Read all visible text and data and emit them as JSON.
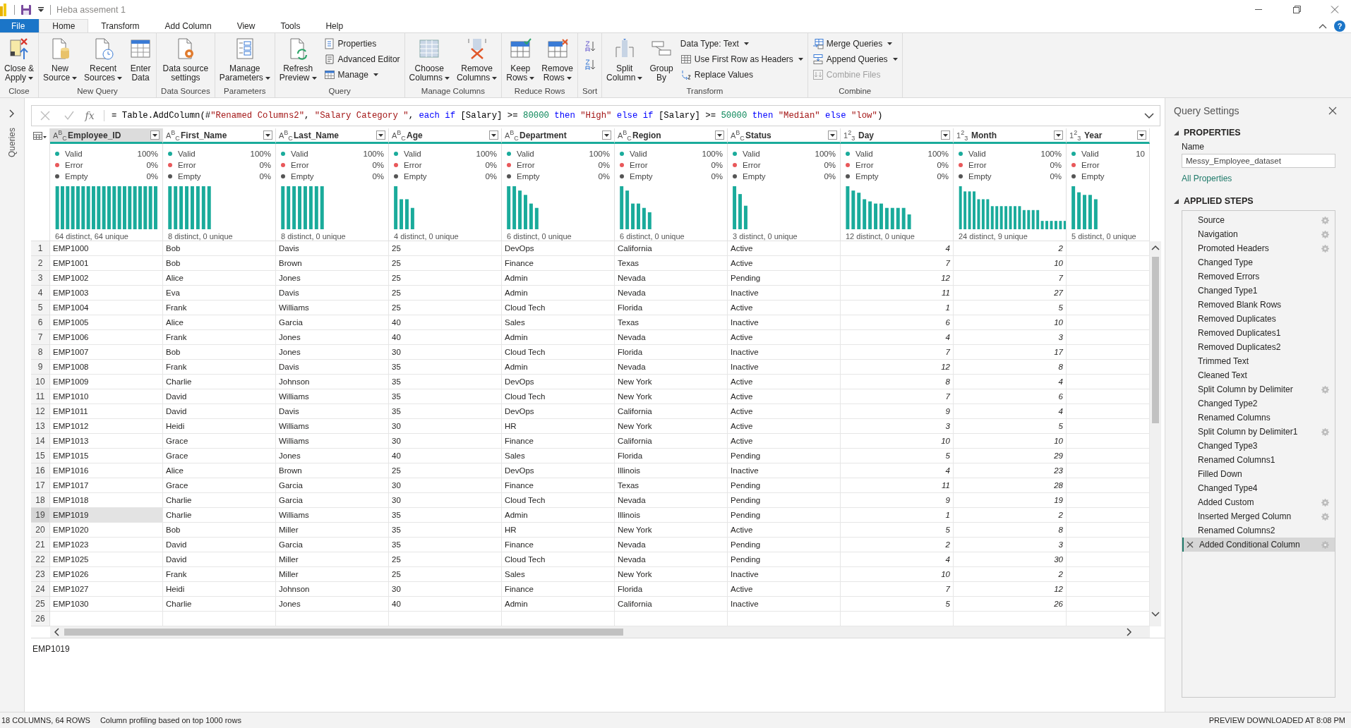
{
  "window": {
    "title": "Heba assement 1"
  },
  "tabs": [
    {
      "label": "File",
      "kind": "file",
      "selected": false
    },
    {
      "label": "Home",
      "kind": "tab",
      "selected": true
    },
    {
      "label": "Transform",
      "kind": "tab",
      "selected": false
    },
    {
      "label": "Add Column",
      "kind": "tab",
      "selected": false
    },
    {
      "label": "View",
      "kind": "tab",
      "selected": false
    },
    {
      "label": "Tools",
      "kind": "tab",
      "selected": false
    },
    {
      "label": "Help",
      "kind": "tab",
      "selected": false
    }
  ],
  "help_button": "?",
  "ribbon": [
    {
      "label": "Close",
      "items": [
        {
          "kind": "large",
          "label": "Close &\nApply",
          "dropdown": true,
          "disabled": false
        }
      ]
    },
    {
      "label": "New Query",
      "items": [
        {
          "kind": "large",
          "label": "New\nSource",
          "dropdown": true,
          "disabled": false
        },
        {
          "kind": "large",
          "label": "Recent\nSources",
          "dropdown": true,
          "disabled": false
        },
        {
          "kind": "large",
          "label": "Enter\nData",
          "dropdown": false,
          "disabled": false
        }
      ]
    },
    {
      "label": "Data Sources",
      "items": [
        {
          "kind": "large",
          "label": "Data source\nsettings",
          "dropdown": false,
          "disabled": false
        }
      ]
    },
    {
      "label": "Parameters",
      "items": [
        {
          "kind": "large",
          "label": "Manage\nParameters",
          "dropdown": true,
          "disabled": false
        }
      ]
    },
    {
      "label": "Query",
      "items": [
        {
          "kind": "large",
          "label": "Refresh\nPreview",
          "dropdown": true,
          "disabled": false
        },
        {
          "kind": "small",
          "label": "Properties",
          "dropdown": false,
          "disabled": false
        },
        {
          "kind": "small",
          "label": "Advanced Editor",
          "dropdown": false,
          "disabled": false
        },
        {
          "kind": "small",
          "label": "Manage",
          "dropdown": true,
          "disabled": false
        }
      ]
    },
    {
      "label": "Manage Columns",
      "items": [
        {
          "kind": "large",
          "label": "Choose\nColumns",
          "dropdown": true,
          "disabled": false
        },
        {
          "kind": "large",
          "label": "Remove\nColumns",
          "dropdown": true,
          "disabled": false
        }
      ]
    },
    {
      "label": "Reduce Rows",
      "items": [
        {
          "kind": "large",
          "label": "Keep\nRows",
          "dropdown": true,
          "disabled": false
        },
        {
          "kind": "large",
          "label": "Remove\nRows",
          "dropdown": true,
          "disabled": false
        }
      ]
    },
    {
      "label": "Sort",
      "items": [
        {
          "kind": "icon"
        },
        {
          "kind": "icon"
        }
      ]
    },
    {
      "label": "Transform",
      "items": [
        {
          "kind": "large",
          "label": "Split\nColumn",
          "dropdown": true,
          "disabled": false
        },
        {
          "kind": "large",
          "label": "Group\nBy",
          "dropdown": false,
          "disabled": false
        },
        {
          "kind": "small",
          "label": "Data Type: Text",
          "dropdown": true,
          "disabled": false
        },
        {
          "kind": "small",
          "label": "Use First Row as Headers",
          "dropdown": true,
          "disabled": false
        },
        {
          "kind": "small",
          "label": "Replace Values",
          "dropdown": false,
          "disabled": false
        }
      ]
    },
    {
      "label": "Combine",
      "items": [
        {
          "kind": "small",
          "label": "Merge Queries",
          "dropdown": true,
          "disabled": false
        },
        {
          "kind": "small",
          "label": "Append Queries",
          "dropdown": true,
          "disabled": false
        },
        {
          "kind": "small",
          "label": "Combine Files",
          "dropdown": false,
          "disabled": true
        }
      ]
    }
  ],
  "queries_pane": {
    "label": "Queries"
  },
  "formula_bar": {
    "fx": "fx",
    "tokens": [
      {
        "kind": "plain",
        "text": "= Table.AddColumn(#"
      },
      {
        "kind": "string",
        "text": "\"Renamed Columns2\""
      },
      {
        "kind": "plain",
        "text": ", "
      },
      {
        "kind": "string",
        "text": "\"Salary Category \""
      },
      {
        "kind": "plain",
        "text": ", "
      },
      {
        "kind": "keyword",
        "text": "each if"
      },
      {
        "kind": "plain",
        "text": " [Salary] >= "
      },
      {
        "kind": "number",
        "text": "80000"
      },
      {
        "kind": "keyword",
        "text": " then "
      },
      {
        "kind": "string",
        "text": "\"High\""
      },
      {
        "kind": "keyword",
        "text": " else if"
      },
      {
        "kind": "plain",
        "text": " [Salary] >= "
      },
      {
        "kind": "number",
        "text": "50000"
      },
      {
        "kind": "keyword",
        "text": " then "
      },
      {
        "kind": "string",
        "text": "\"Median\""
      },
      {
        "kind": "keyword",
        "text": " else "
      },
      {
        "kind": "string",
        "text": "\"low\""
      },
      {
        "kind": "plain",
        "text": ")"
      }
    ]
  },
  "table": {
    "columns": [
      {
        "name": "Employee_ID",
        "kind": "text",
        "type_label": "A$^{B}$$_{C}$",
        "selected": true,
        "quality": [
          {
            "label": "Valid",
            "pct": "100%",
            "color": "#1aab9b"
          },
          {
            "label": "Error",
            "pct": "0%",
            "color": "#e8585a"
          },
          {
            "label": "Empty",
            "pct": "0%",
            "color": "#555555"
          }
        ],
        "summary": "64 distinct, 64 unique"
      },
      {
        "name": "First_Name",
        "kind": "text",
        "type_label": "A$^{B}$$_{C}$",
        "selected": false,
        "quality": [
          {
            "label": "Valid",
            "pct": "100%",
            "color": "#1aab9b"
          },
          {
            "label": "Error",
            "pct": "0%",
            "color": "#e8585a"
          },
          {
            "label": "Empty",
            "pct": "0%",
            "color": "#555555"
          }
        ],
        "summary": "8 distinct, 0 unique"
      },
      {
        "name": "Last_Name",
        "kind": "text",
        "type_label": "A$^{B}$$_{C}$",
        "selected": false,
        "quality": [
          {
            "label": "Valid",
            "pct": "100%",
            "color": "#1aab9b"
          },
          {
            "label": "Error",
            "pct": "0%",
            "color": "#e8585a"
          },
          {
            "label": "Empty",
            "pct": "0%",
            "color": "#555555"
          }
        ],
        "summary": "8 distinct, 0 unique"
      },
      {
        "name": "Age",
        "kind": "text",
        "type_label": "A$^{B}$$_{C}$",
        "selected": false,
        "quality": [
          {
            "label": "Valid",
            "pct": "100%",
            "color": "#1aab9b"
          },
          {
            "label": "Error",
            "pct": "0%",
            "color": "#e8585a"
          },
          {
            "label": "Empty",
            "pct": "0%",
            "color": "#555555"
          }
        ],
        "summary": "4 distinct, 0 unique"
      },
      {
        "name": "Department",
        "kind": "text",
        "type_label": "A$^{B}$$_{C}$",
        "selected": false,
        "quality": [
          {
            "label": "Valid",
            "pct": "100%",
            "color": "#1aab9b"
          },
          {
            "label": "Error",
            "pct": "0%",
            "color": "#e8585a"
          },
          {
            "label": "Empty",
            "pct": "0%",
            "color": "#555555"
          }
        ],
        "summary": "6 distinct, 0 unique"
      },
      {
        "name": "Region",
        "kind": "text",
        "type_label": "A$^{B}$$_{C}$",
        "selected": false,
        "quality": [
          {
            "label": "Valid",
            "pct": "100%",
            "color": "#1aab9b"
          },
          {
            "label": "Error",
            "pct": "0%",
            "color": "#e8585a"
          },
          {
            "label": "Empty",
            "pct": "0%",
            "color": "#555555"
          }
        ],
        "summary": "6 distinct, 0 unique"
      },
      {
        "name": "Status",
        "kind": "text",
        "type_label": "A$^{B}$$_{C}$",
        "selected": false,
        "quality": [
          {
            "label": "Valid",
            "pct": "100%",
            "color": "#1aab9b"
          },
          {
            "label": "Error",
            "pct": "0%",
            "color": "#e8585a"
          },
          {
            "label": "Empty",
            "pct": "0%",
            "color": "#555555"
          }
        ],
        "summary": "3 distinct, 0 unique"
      },
      {
        "name": "Day",
        "kind": "number",
        "type_label": "1$^{2}$$_{3}$",
        "selected": false,
        "quality": [
          {
            "label": "Valid",
            "pct": "100%",
            "color": "#1aab9b"
          },
          {
            "label": "Error",
            "pct": "0%",
            "color": "#e8585a"
          },
          {
            "label": "Empty",
            "pct": "0%",
            "color": "#555555"
          }
        ],
        "summary": "12 distinct, 0 unique"
      },
      {
        "name": "Month",
        "kind": "number",
        "type_label": "1$^{2}$$_{3}$",
        "selected": false,
        "quality": [
          {
            "label": "Valid",
            "pct": "100%",
            "color": "#1aab9b"
          },
          {
            "label": "Error",
            "pct": "0%",
            "color": "#e8585a"
          },
          {
            "label": "Empty",
            "pct": "0%",
            "color": "#555555"
          }
        ],
        "summary": "24 distinct, 9 unique"
      },
      {
        "name": "Year",
        "kind": "number",
        "type_label": "1$^{2}$$_{3}$",
        "selected": false,
        "quality": [
          {
            "label": "Valid",
            "pct": "10",
            "color": "#1aab9b"
          },
          {
            "label": "Error",
            "color": "#e8585a"
          },
          {
            "label": "Empty",
            "color": "#555555"
          }
        ],
        "summary": "5 distinct, 0 unique"
      }
    ],
    "rows": [
      {
        "number": "1",
        "selected": false,
        "cells": [
          "EMP1000",
          "Bob",
          "Davis",
          "25",
          "DevOps",
          "California",
          "Active",
          "4",
          "2"
        ]
      },
      {
        "number": "2",
        "selected": false,
        "cells": [
          "EMP1001",
          "Bob",
          "Brown",
          "25",
          "Finance",
          "Texas",
          "Active",
          "7",
          "10"
        ]
      },
      {
        "number": "3",
        "selected": false,
        "cells": [
          "EMP1002",
          "Alice",
          "Jones",
          "25",
          "Admin",
          "Nevada",
          "Pending",
          "12",
          "7"
        ]
      },
      {
        "number": "4",
        "selected": false,
        "cells": [
          "EMP1003",
          "Eva",
          "Davis",
          "25",
          "Admin",
          "Nevada",
          "Inactive",
          "11",
          "27"
        ]
      },
      {
        "number": "5",
        "selected": false,
        "cells": [
          "EMP1004",
          "Frank",
          "Williams",
          "25",
          "Cloud Tech",
          "Florida",
          "Active",
          "1",
          "5"
        ]
      },
      {
        "number": "6",
        "selected": false,
        "cells": [
          "EMP1005",
          "Alice",
          "Garcia",
          "40",
          "Sales",
          "Texas",
          "Inactive",
          "6",
          "10"
        ]
      },
      {
        "number": "7",
        "selected": false,
        "cells": [
          "EMP1006",
          "Frank",
          "Jones",
          "40",
          "Admin",
          "Nevada",
          "Active",
          "4",
          "3"
        ]
      },
      {
        "number": "8",
        "selected": false,
        "cells": [
          "EMP1007",
          "Bob",
          "Jones",
          "30",
          "Cloud Tech",
          "Florida",
          "Inactive",
          "7",
          "17"
        ]
      },
      {
        "number": "9",
        "selected": false,
        "cells": [
          "EMP1008",
          "Frank",
          "Davis",
          "35",
          "Admin",
          "Nevada",
          "Inactive",
          "12",
          "8"
        ]
      },
      {
        "number": "10",
        "selected": false,
        "cells": [
          "EMP1009",
          "Charlie",
          "Johnson",
          "35",
          "DevOps",
          "New York",
          "Active",
          "8",
          "4"
        ]
      },
      {
        "number": "11",
        "selected": false,
        "cells": [
          "EMP1010",
          "David",
          "Williams",
          "35",
          "Cloud Tech",
          "New York",
          "Active",
          "7",
          "6"
        ]
      },
      {
        "number": "12",
        "selected": false,
        "cells": [
          "EMP1011",
          "David",
          "Davis",
          "35",
          "DevOps",
          "California",
          "Active",
          "9",
          "4"
        ]
      },
      {
        "number": "13",
        "selected": false,
        "cells": [
          "EMP1012",
          "Heidi",
          "Williams",
          "30",
          "HR",
          "New York",
          "Active",
          "3",
          "5"
        ]
      },
      {
        "number": "14",
        "selected": false,
        "cells": [
          "EMP1013",
          "Grace",
          "Williams",
          "30",
          "Finance",
          "California",
          "Active",
          "10",
          "10"
        ]
      },
      {
        "number": "15",
        "selected": false,
        "cells": [
          "EMP1015",
          "Grace",
          "Jones",
          "40",
          "Sales",
          "Florida",
          "Pending",
          "5",
          "29"
        ]
      },
      {
        "number": "16",
        "selected": false,
        "cells": [
          "EMP1016",
          "Alice",
          "Brown",
          "25",
          "DevOps",
          "Illinois",
          "Inactive",
          "4",
          "23"
        ]
      },
      {
        "number": "17",
        "selected": false,
        "cells": [
          "EMP1017",
          "Grace",
          "Garcia",
          "30",
          "Finance",
          "Texas",
          "Pending",
          "11",
          "28"
        ]
      },
      {
        "number": "18",
        "selected": false,
        "cells": [
          "EMP1018",
          "Charlie",
          "Garcia",
          "30",
          "Cloud Tech",
          "Nevada",
          "Pending",
          "9",
          "19"
        ]
      },
      {
        "number": "19",
        "selected": true,
        "cells": [
          "EMP1019",
          "Charlie",
          "Williams",
          "35",
          "Admin",
          "Illinois",
          "Pending",
          "1",
          "2"
        ]
      },
      {
        "number": "20",
        "selected": false,
        "cells": [
          "EMP1020",
          "Bob",
          "Miller",
          "35",
          "HR",
          "New York",
          "Active",
          "5",
          "8"
        ]
      },
      {
        "number": "21",
        "selected": false,
        "cells": [
          "EMP1023",
          "David",
          "Garcia",
          "35",
          "Finance",
          "Nevada",
          "Pending",
          "2",
          "3"
        ]
      },
      {
        "number": "22",
        "selected": false,
        "cells": [
          "EMP1025",
          "David",
          "Miller",
          "25",
          "Cloud Tech",
          "Nevada",
          "Pending",
          "4",
          "30"
        ]
      },
      {
        "number": "23",
        "selected": false,
        "cells": [
          "EMP1026",
          "Frank",
          "Miller",
          "25",
          "Sales",
          "New York",
          "Inactive",
          "10",
          "2"
        ]
      },
      {
        "number": "24",
        "selected": false,
        "cells": [
          "EMP1027",
          "Heidi",
          "Johnson",
          "30",
          "Finance",
          "Florida",
          "Active",
          "7",
          "12"
        ]
      },
      {
        "number": "25",
        "selected": false,
        "cells": [
          "EMP1030",
          "Charlie",
          "Jones",
          "40",
          "Admin",
          "California",
          "Inactive",
          "5",
          "26"
        ]
      },
      {
        "number": "26",
        "selected": false
      }
    ]
  },
  "preview": {
    "value": "EMP1019"
  },
  "query_settings": {
    "title": "Query Settings",
    "properties_header": "PROPERTIES",
    "name_label": "Name",
    "name_value": "Messy_Employee_dataset",
    "all_properties": "All Properties",
    "steps_header": "APPLIED STEPS",
    "steps": [
      {
        "label": "Source",
        "settings": true,
        "selected": false
      },
      {
        "label": "Navigation",
        "settings": true,
        "selected": false
      },
      {
        "label": "Promoted Headers",
        "settings": true,
        "selected": false
      },
      {
        "label": "Changed Type",
        "settings": false,
        "selected": false
      },
      {
        "label": "Removed Errors",
        "settings": false,
        "selected": false
      },
      {
        "label": "Changed Type1",
        "settings": false,
        "selected": false
      },
      {
        "label": "Removed Blank Rows",
        "settings": false,
        "selected": false
      },
      {
        "label": "Removed Duplicates",
        "settings": false,
        "selected": false
      },
      {
        "label": "Removed Duplicates1",
        "settings": false,
        "selected": false
      },
      {
        "label": "Removed Duplicates2",
        "settings": false,
        "selected": false
      },
      {
        "label": "Trimmed Text",
        "settings": false,
        "selected": false
      },
      {
        "label": "Cleaned Text",
        "settings": false,
        "selected": false
      },
      {
        "label": "Split Column by Delimiter",
        "settings": true,
        "selected": false
      },
      {
        "label": "Changed Type2",
        "settings": false,
        "selected": false
      },
      {
        "label": "Renamed Columns",
        "settings": false,
        "selected": false
      },
      {
        "label": "Split Column by Delimiter1",
        "settings": true,
        "selected": false
      },
      {
        "label": "Changed Type3",
        "settings": false,
        "selected": false
      },
      {
        "label": "Renamed Columns1",
        "settings": false,
        "selected": false
      },
      {
        "label": "Filled Down",
        "settings": false,
        "selected": false
      },
      {
        "label": "Changed Type4",
        "settings": false,
        "selected": false
      },
      {
        "label": "Added Custom",
        "settings": true,
        "selected": false
      },
      {
        "label": "Inserted Merged Column",
        "settings": true,
        "selected": false
      },
      {
        "label": "Renamed Columns2",
        "settings": false,
        "selected": false
      },
      {
        "label": "Added Conditional Column",
        "settings": true,
        "selected": true
      }
    ]
  },
  "status_bar": {
    "counts": "18 COLUMNS, 64 ROWS",
    "profiling": "Column profiling based on top 1000 rows",
    "downloaded": "PREVIEW DOWNLOADED AT 8:08 PM"
  }
}
